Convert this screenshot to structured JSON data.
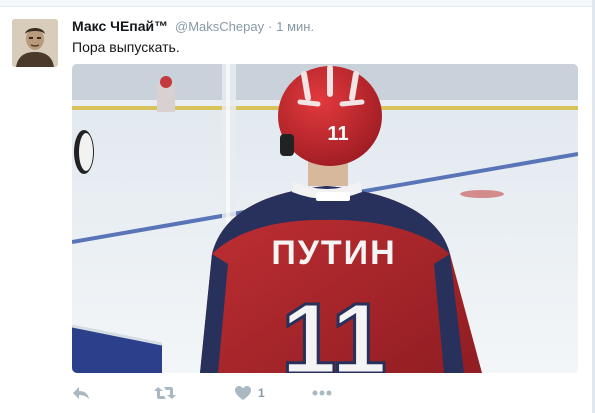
{
  "tweet": {
    "fullname": "Макс ЧЕпай™",
    "username": "@MaksChepay",
    "separator": "·",
    "time": "1 мин.",
    "text": "Пора выпускать.",
    "media": {
      "jersey_name": "ПУТИН",
      "jersey_number": "11",
      "helmet_number": "11"
    },
    "actions": {
      "reply_icon": "reply-icon",
      "retweet_icon": "retweet-icon",
      "like_icon": "heart-icon",
      "like_count": "1",
      "more_icon": "more-dots-icon"
    }
  },
  "colors": {
    "name": "#14171a",
    "meta": "#8899a6",
    "icon": "#aab8c2",
    "jersey_red": "#b0282c",
    "jersey_blue": "#27315c"
  }
}
